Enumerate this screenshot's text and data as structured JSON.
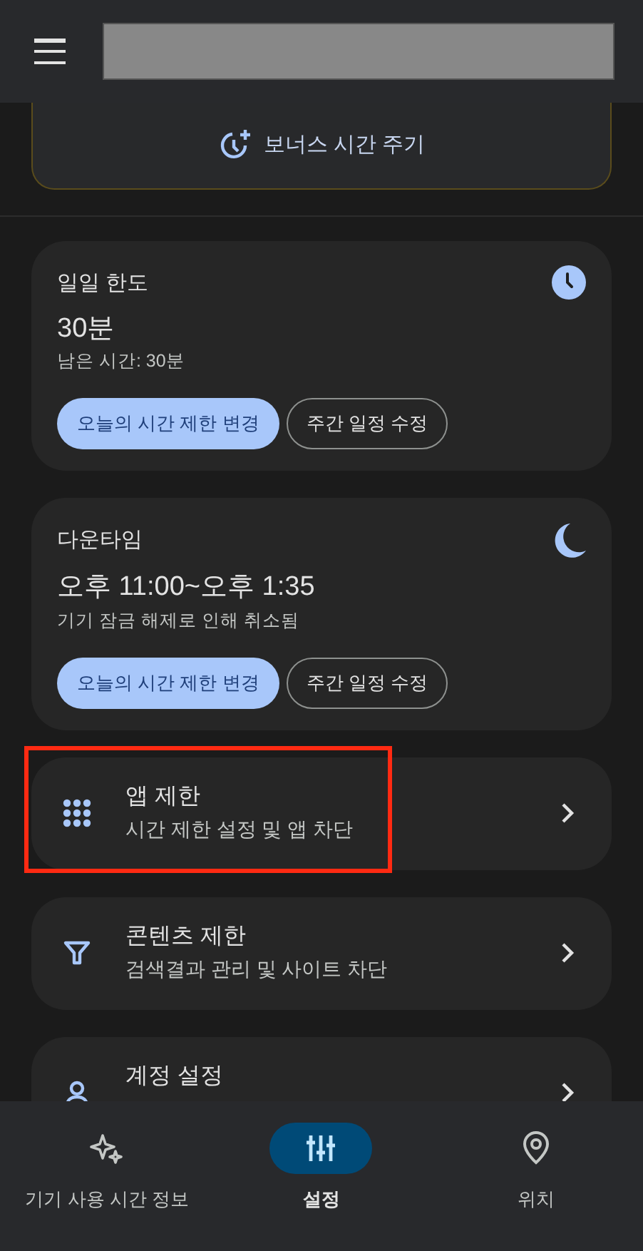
{
  "bonus": {
    "label": "보너스 시간 주기"
  },
  "limit_cards": [
    {
      "kind": "daily_limit",
      "title": "일일 한도",
      "value": "30분",
      "note": "남은 시간: 30분",
      "buttons": [
        {
          "kind": "filled",
          "label": "오늘의 시간 제한 변경"
        },
        {
          "kind": "outlined",
          "label": "주간 일정 수정"
        }
      ]
    },
    {
      "kind": "downtime",
      "title": "다운타임",
      "value": "오후 11:00~오후 1:35",
      "note": "기기 잠금 해제로 인해 취소됨",
      "buttons": [
        {
          "kind": "filled",
          "label": "오늘의 시간 제한 변경"
        },
        {
          "kind": "outlined",
          "label": "주간 일정 수정"
        }
      ]
    }
  ],
  "settings_items": [
    {
      "kind": "apps",
      "title": "앱 제한",
      "subtitle": "시간 제한 설정 및 앱 차단",
      "highlighted": true
    },
    {
      "kind": "content",
      "title": "콘텐츠 제한",
      "subtitle": "검색결과 관리 및 사이트 차단",
      "highlighted": false
    },
    {
      "kind": "account",
      "title": "계정 설정",
      "highlighted": false
    }
  ],
  "bottom_nav": [
    {
      "kind": "screen_time",
      "label": "기기 사용 시간 정보",
      "selected": false
    },
    {
      "kind": "settings",
      "label": "설정",
      "selected": true
    },
    {
      "kind": "location",
      "label": "위치",
      "selected": false
    }
  ]
}
